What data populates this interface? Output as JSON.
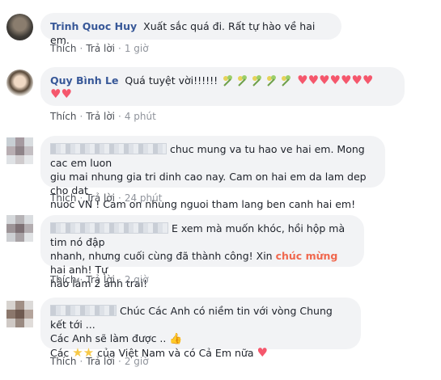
{
  "comments": [
    {
      "author": "Trinh Quoc Huy",
      "text": "Xuất sắc quá đi. Rất tự hào về hai em.",
      "like": "Thích",
      "reply": "Trả lời",
      "time": "1 giờ"
    },
    {
      "author": "Quy Bình Le",
      "text": "Quá tuyệt vời!!!!!!",
      "like": "Thích",
      "reply": "Trả lời",
      "time": "4 phút",
      "flower_count": 5,
      "heart_count": 9
    },
    {
      "author": "",
      "line1": "chuc mung va tu hao ve hai em. Mong cac em luon",
      "line2": "giu mai nhung gia tri dinh cao nay. Cam on hai em da lam dep cho dat",
      "line3": "nuoc VN ! Cam on nhung nguoi tham lang ben canh hai em!",
      "like": "Thích",
      "reply": "Trả lời",
      "time": "24 phút"
    },
    {
      "author": "",
      "line1": "E xem mà muốn khóc, hồi hộp mà tim nó đập",
      "line2": "nhanh, nhưng cuối cùng đã thành công! Xin",
      "highlight": "chúc mừng",
      "line2b": "hai anh! Tự",
      "line3": "hào lắm 2 anh trai!",
      "like": "Thích",
      "reply": "Trả lời",
      "time": "2 giờ"
    },
    {
      "author": "",
      "line1": "Chúc Các Anh có niềm tin với vòng Chung kết tới ...",
      "line2": "Các Anh sẽ làm được ..",
      "line3a": "Các",
      "line3b": "của Việt Nam và có Cả Em nữa",
      "like": "Thích",
      "reply": "Trả lời",
      "time": "2 giờ"
    }
  ],
  "separator": "·"
}
